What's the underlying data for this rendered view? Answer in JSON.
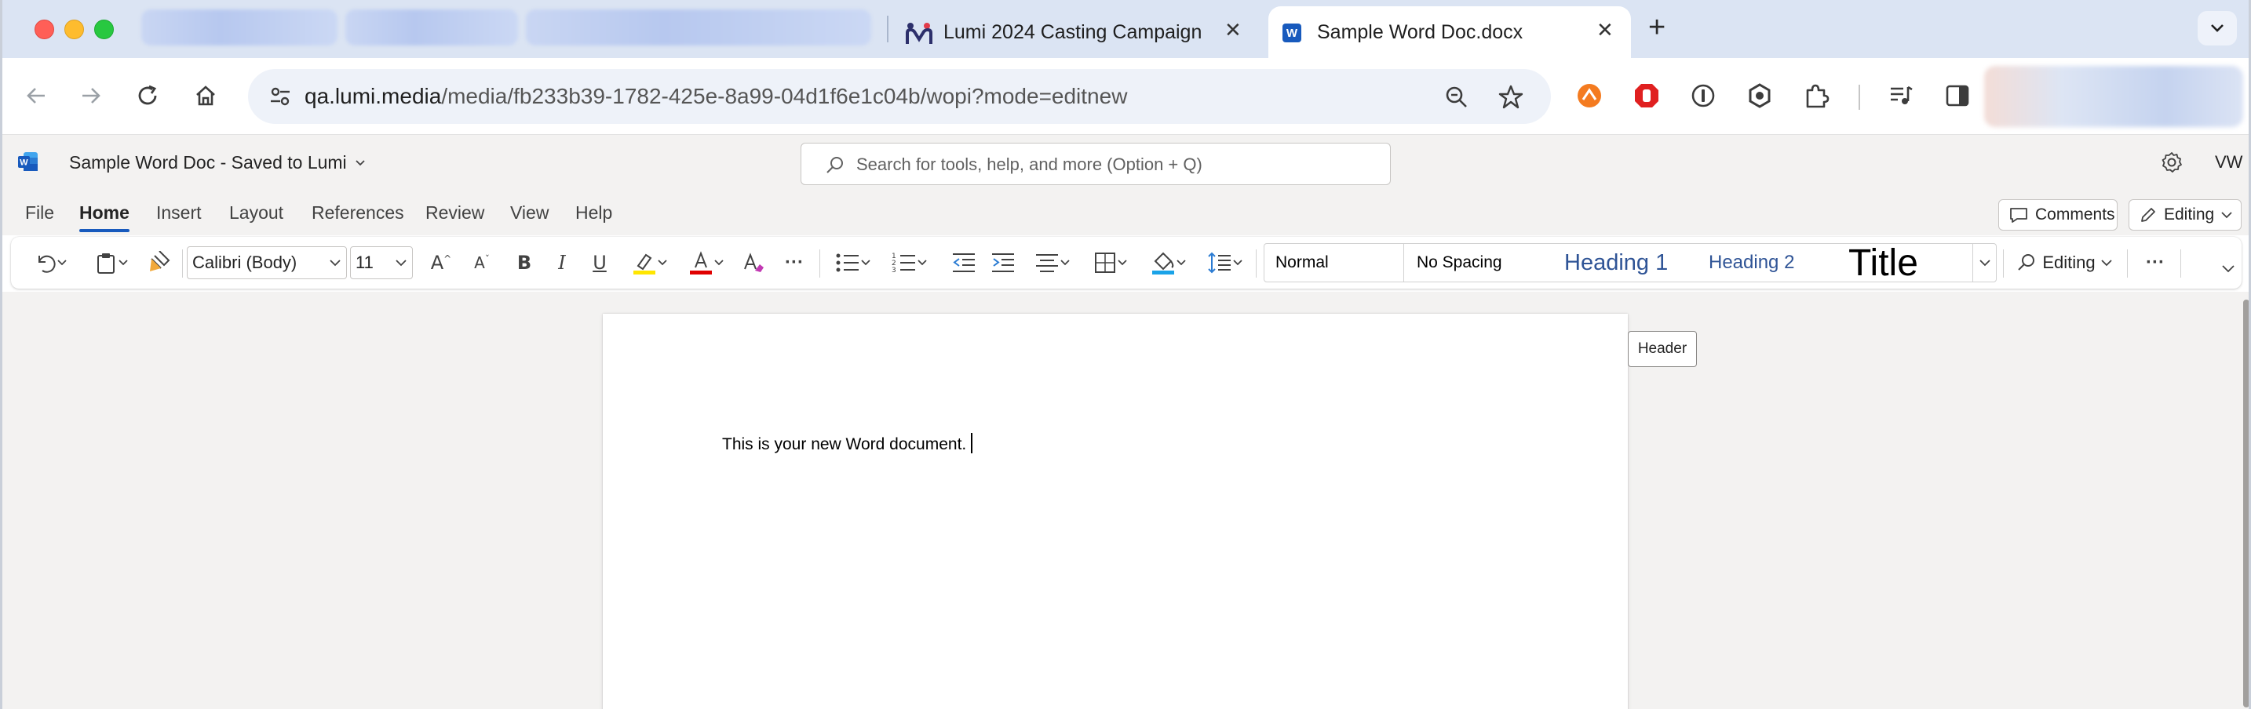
{
  "browser": {
    "tabs": [
      {
        "title": "Lumi 2024 Casting Campaign",
        "favicon": "lumi-icon",
        "close": "✕"
      },
      {
        "title": "Sample Word Doc.docx",
        "favicon": "word-icon",
        "close": "✕",
        "active": true
      }
    ],
    "new_tab": "+",
    "address": {
      "host": "qa.lumi.media",
      "path": "/media/fb233b39-1782-425e-8a99-04d1f6e1c04b/wopi?mode=editnew"
    }
  },
  "word": {
    "logo": "W",
    "doc_title": "Sample Word Doc  -  Saved to Lumi",
    "search_placeholder": "Search for tools, help, and more (Option + Q)",
    "user_initials": "VW",
    "ribbon_tabs": [
      "File",
      "Home",
      "Insert",
      "Layout",
      "References",
      "Review",
      "View",
      "Help"
    ],
    "comments_label": "Comments",
    "editing_label": "Editing",
    "font_name": "Calibri (Body)",
    "font_size": "11",
    "styles": {
      "normal": "Normal",
      "no_spacing": "No Spacing",
      "heading1": "Heading 1",
      "heading2": "Heading 2",
      "title": "Title"
    },
    "editing_mode": "Editing",
    "more": "···",
    "header_tooltip": "Header",
    "document_text": "This is your new Word document."
  },
  "colors": {
    "word_blue": "#185abd",
    "highlight_yellow": "#ffe600",
    "font_red": "#e00000",
    "shading_blue": "#1aa3e8",
    "heading_blue": "#2f5496"
  }
}
